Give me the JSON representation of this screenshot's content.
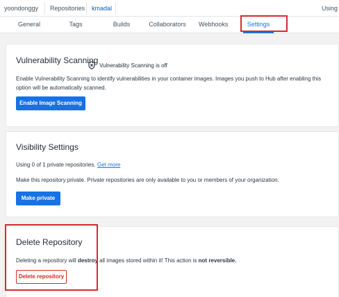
{
  "breadcrumb": {
    "items": [
      "yoondonggy",
      "Repositories",
      "kmadal"
    ]
  },
  "header": {
    "using_text": "Using"
  },
  "tabs": [
    {
      "label": "General"
    },
    {
      "label": "Tags"
    },
    {
      "label": "Builds"
    },
    {
      "label": "Collaborators"
    },
    {
      "label": "Webhooks"
    },
    {
      "label": "Settings",
      "selected": true
    }
  ],
  "vulnerability": {
    "title": "Vulnerability Scanning",
    "description": "Enable Vulnerability Scanning to identify vulnerabilities in your container images. Images you push to Hub after enabling this option will be automatically scanned.",
    "button_label": "Enable Image Scanning",
    "status_icon": "shield-off-icon",
    "status_text": "Vulnerability Scanning is off"
  },
  "visibility": {
    "title": "Visibility Settings",
    "usage_text": "Using 0 of 1 private repositories.",
    "get_more_link": "Get more",
    "description": "Make this repository private. Private repositories are only available to you or members of your organization.",
    "button_label": "Make private"
  },
  "delete": {
    "title": "Delete Repository",
    "text_before": "Deleting a repository will ",
    "text_bold_1": "destroy",
    "text_middle": " all images stored within it! This action is ",
    "text_bold_2": "not reversible.",
    "button_label": "Delete repository"
  },
  "colors": {
    "accent": "#1672e6",
    "danger": "#d5281f",
    "highlight": "#d7282f"
  }
}
